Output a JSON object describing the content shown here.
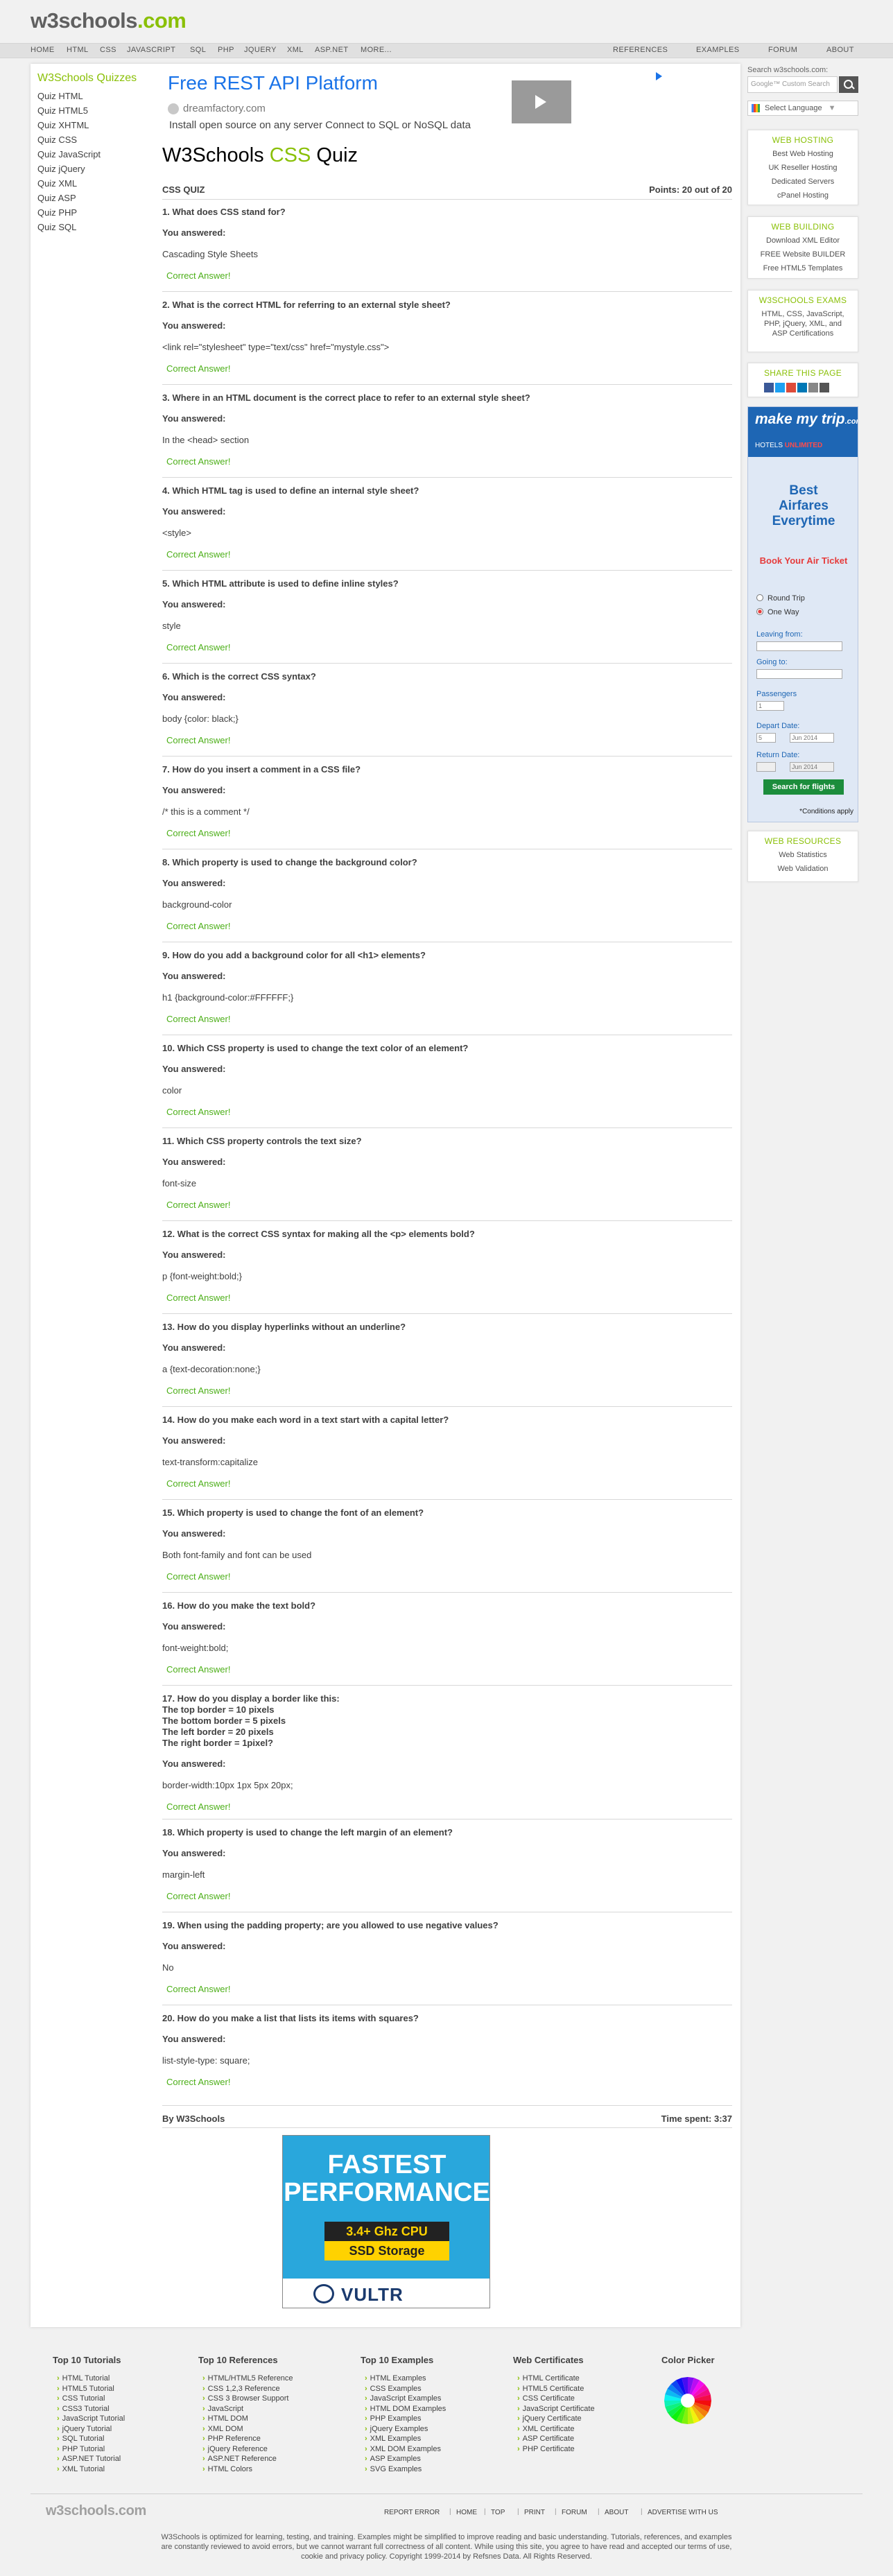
{
  "header": {
    "logo": {
      "w3": "w3schools",
      "dot": ".com"
    },
    "nav_left": [
      "HOME",
      "HTML",
      "CSS",
      "JAVASCRIPT",
      "SQL",
      "PHP",
      "JQUERY",
      "XML",
      "ASP.NET",
      "MORE..."
    ],
    "nav_right": [
      "REFERENCES",
      "EXAMPLES",
      "FORUM",
      "ABOUT"
    ]
  },
  "left_menu": {
    "title": "W3Schools Quizzes",
    "items": [
      "Quiz HTML",
      "Quiz HTML5",
      "Quiz XHTML",
      "Quiz CSS",
      "Quiz JavaScript",
      "Quiz jQuery",
      "Quiz XML",
      "Quiz ASP",
      "Quiz PHP",
      "Quiz SQL"
    ]
  },
  "ad": {
    "title": "Free REST API Platform",
    "url": "dreamfactory.com",
    "desc": "Install open source on any server Connect to SQL or NoSQL data"
  },
  "quiz": {
    "title_pre": "W3Schools ",
    "title_css": "CSS",
    "title_post": " Quiz",
    "label": "CSS QUIZ",
    "points": "Points: 20 out of 20",
    "answered_label": "You answered:",
    "correct_label": "Correct Answer!",
    "questions": [
      {
        "q": "1. What does CSS stand for?",
        "a": "Cascading Style Sheets"
      },
      {
        "q": "2. What is the correct HTML for referring to an external style sheet?",
        "a": "<link rel=\"stylesheet\" type=\"text/css\" href=\"mystyle.css\">"
      },
      {
        "q": "3. Where in an HTML document is the correct place to refer to an external style sheet?",
        "a": "In the <head> section"
      },
      {
        "q": "4. Which HTML tag is used to define an internal style sheet?",
        "a": "<style>"
      },
      {
        "q": "5. Which HTML attribute is used to define inline styles?",
        "a": "style"
      },
      {
        "q": "6. Which is the correct CSS syntax?",
        "a": "body {color: black;}"
      },
      {
        "q": "7. How do you insert a comment in a CSS file?",
        "a": "/* this is a comment */"
      },
      {
        "q": "8. Which property is used to change the background color?",
        "a": "background-color"
      },
      {
        "q": "9. How do you add a background color for all <h1> elements?",
        "a": "h1 {background-color:#FFFFFF;}"
      },
      {
        "q": "10. Which CSS property is used to change the text color of an element?",
        "a": "color"
      },
      {
        "q": "11. Which CSS property controls the text size?",
        "a": "font-size"
      },
      {
        "q": "12. What is the correct CSS syntax for making all the <p> elements bold?",
        "a": "p {font-weight:bold;}"
      },
      {
        "q": "13. How do you display hyperlinks without an underline?",
        "a": "a {text-decoration:none;}"
      },
      {
        "q": "14. How do you make each word in a text start with a capital letter?",
        "a": "text-transform:capitalize"
      },
      {
        "q": "15. Which property is used to change the font of an element?",
        "a": "Both font-family and font can be used"
      },
      {
        "q": "16. How do you make the text bold?",
        "a": "font-weight:bold;"
      },
      {
        "q": "17. How do you display a border like this:\nThe top border = 10 pixels\nThe bottom border = 5 pixels\nThe left border = 20 pixels\nThe right border = 1pixel?",
        "a": "border-width:10px 1px 5px 20px;"
      },
      {
        "q": "18. Which property is used to change the left margin of an element?",
        "a": "margin-left"
      },
      {
        "q": "19. When using the padding property; are you allowed to use negative values?",
        "a": "No"
      },
      {
        "q": "20. How do you make a list that lists its items with squares?",
        "a": "list-style-type: square;"
      }
    ],
    "by": "By W3Schools",
    "time": "Time spent: 3:37"
  },
  "vultr_ad": {
    "line1": "FASTEST",
    "line2": "PERFORMANCE",
    "cpu": "3.4+ Ghz CPU",
    "ssd": "SSD Storage",
    "brand": "VULTR"
  },
  "sidebar": {
    "search_label": "Search w3schools.com:",
    "search_placeholder": "Google™ Custom Search",
    "language": "Select Language",
    "language_caret": "▼",
    "boxes": [
      {
        "title": "WEB HOSTING",
        "links": [
          "Best Web Hosting",
          "UK Reseller Hosting",
          "Dedicated Servers",
          "cPanel Hosting"
        ]
      },
      {
        "title": "WEB BUILDING",
        "links": [
          "Download XML Editor",
          "FREE Website BUILDER",
          "Free HTML5 Templates"
        ]
      },
      {
        "title": "W3SCHOOLS EXAMS",
        "links": [
          "HTML, CSS, JavaScript, PHP, jQuery, XML, and ASP Certifications"
        ]
      },
      {
        "title": "SHARE THIS PAGE",
        "links": []
      },
      {
        "title": "WEB RESOURCES",
        "links": [
          "Web Statistics",
          "Web Validation"
        ]
      }
    ],
    "share_colors": [
      "#3b5998",
      "#1da1f2",
      "#dd4b39",
      "#0077b5",
      "#888888",
      "#555555"
    ],
    "mmt": {
      "logo": "make my trip",
      "logo_suffix": ".com",
      "sub_hotels": "HOTELS",
      "sub_unlimited": "UNLIMITED",
      "best": "Best\nAirfares\nEverytime",
      "book": "Book Your Air Ticket",
      "round_trip": "Round Trip",
      "one_way": "One Way",
      "leaving": "Leaving from:",
      "going": "Going to:",
      "passengers": "Passengers",
      "passengers_value": "1",
      "depart": "Depart Date:",
      "depart_day": "5",
      "depart_month": "Jun 2014",
      "return": "Return Date:",
      "return_month": "Jun 2014",
      "search": "Search for flights",
      "conditions": "*Conditions apply"
    }
  },
  "footer": {
    "columns": [
      {
        "title": "Top 10 Tutorials",
        "links": [
          "HTML Tutorial",
          "HTML5 Tutorial",
          "CSS Tutorial",
          "CSS3 Tutorial",
          "JavaScript Tutorial",
          "jQuery Tutorial",
          "SQL Tutorial",
          "PHP Tutorial",
          "ASP.NET Tutorial",
          "XML Tutorial"
        ]
      },
      {
        "title": "Top 10 References",
        "links": [
          "HTML/HTML5 Reference",
          "CSS 1,2,3 Reference",
          "CSS 3 Browser Support",
          "JavaScript",
          "HTML DOM",
          "XML DOM",
          "PHP Reference",
          "jQuery Reference",
          "ASP.NET Reference",
          "HTML Colors"
        ]
      },
      {
        "title": "Top 10 Examples",
        "links": [
          "HTML Examples",
          "CSS Examples",
          "JavaScript Examples",
          "HTML DOM Examples",
          "PHP Examples",
          "jQuery Examples",
          "XML Examples",
          "XML DOM Examples",
          "ASP Examples",
          "SVG Examples"
        ]
      },
      {
        "title": "Web Certificates",
        "links": [
          "HTML Certificate",
          "HTML5 Certificate",
          "CSS Certificate",
          "JavaScript Certificate",
          "jQuery Certificate",
          "XML Certificate",
          "ASP Certificate",
          "PHP Certificate"
        ]
      },
      {
        "title": "Color Picker",
        "links": []
      }
    ],
    "logo": "w3schools.com",
    "nav": [
      "REPORT ERROR",
      "HOME",
      "TOP",
      "PRINT",
      "FORUM",
      "ABOUT",
      "ADVERTISE WITH US"
    ],
    "disclaimer": "W3Schools is optimized for learning, testing, and training. Examples might be simplified to improve reading and basic understanding. Tutorials, references, and examples\nare constantly reviewed to avoid errors, but we cannot warrant full correctness of all content. While using this site, you agree to have read and accepted our terms of use,\ncookie and privacy policy. Copyright 1999-2014 by Refsnes Data. All Rights Reserved."
  }
}
